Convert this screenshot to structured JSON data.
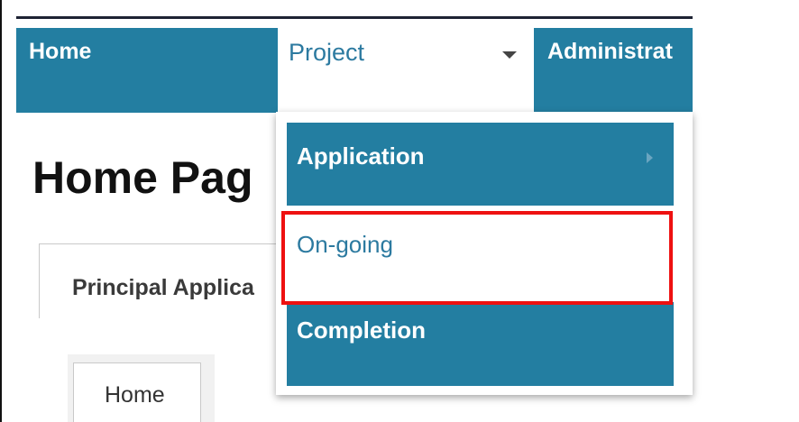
{
  "navbar": {
    "home_label": "Home",
    "project_label": "Project",
    "admin_label": "Administrat"
  },
  "page": {
    "title": "Home Pag"
  },
  "tabs": {
    "principal_label": "Principal Applica",
    "sub_home_label": "Home"
  },
  "dropdown": {
    "items": [
      {
        "label": "Application"
      },
      {
        "label": "On-going"
      },
      {
        "label": "Completion"
      }
    ]
  },
  "colors": {
    "nav_bg": "#237ea1",
    "highlight": "#ee1111"
  }
}
